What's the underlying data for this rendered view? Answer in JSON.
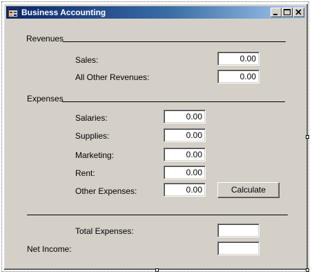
{
  "window": {
    "title": "Business Accounting"
  },
  "revenues": {
    "header": "Revenues",
    "sales_label": "Sales:",
    "sales_value": "0.00",
    "other_label": "All Other Revenues:",
    "other_value": "0.00"
  },
  "expenses": {
    "header": "Expenses",
    "salaries_label": "Salaries:",
    "salaries_value": "0.00",
    "supplies_label": "Supplies:",
    "supplies_value": "0.00",
    "marketing_label": "Marketing:",
    "marketing_value": "0.00",
    "rent_label": "Rent:",
    "rent_value": "0.00",
    "other_label": "Other Expenses:",
    "other_value": "0.00",
    "calculate_label": "Calculate"
  },
  "summary": {
    "total_expenses_label": "Total Expenses:",
    "total_expenses_value": "",
    "net_income_label": "Net Income:",
    "net_income_value": ""
  },
  "icons": {
    "app": "form-icon",
    "minimize": "minimize-icon",
    "maximize": "maximize-icon",
    "close": "close-icon"
  }
}
